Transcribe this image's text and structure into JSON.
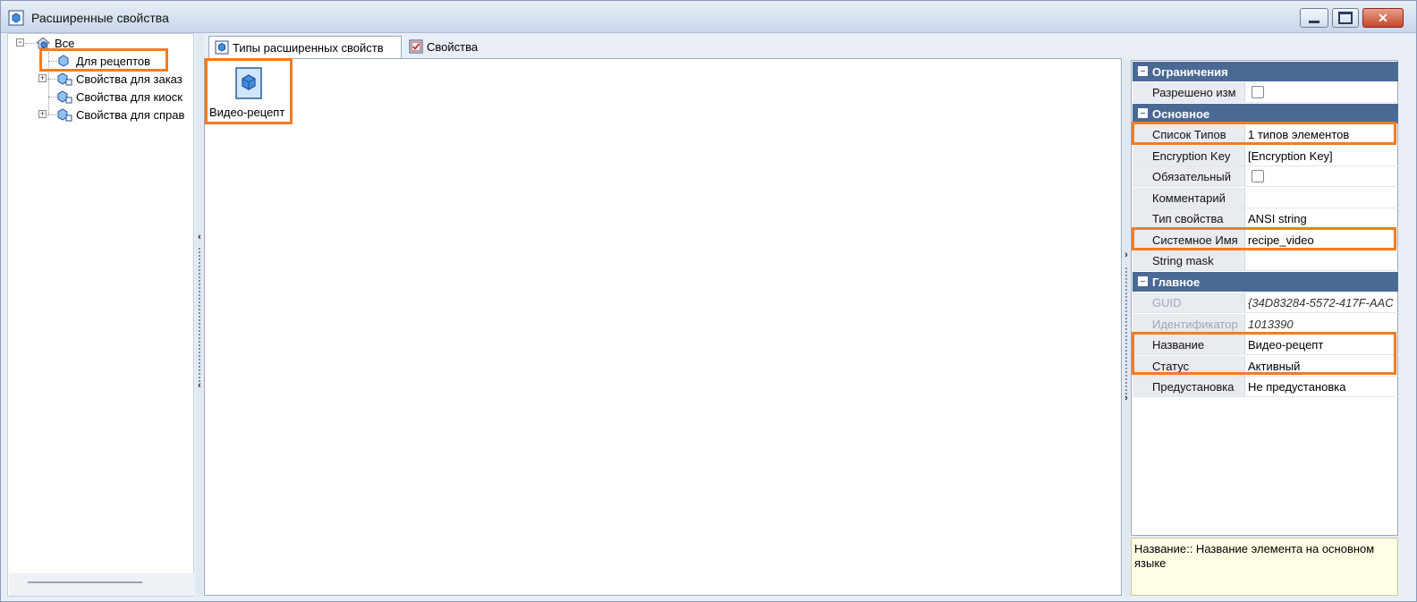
{
  "window": {
    "title": "Расширенные свойства"
  },
  "tree": {
    "root": "Все",
    "items": [
      {
        "label": "Для рецептов",
        "expandable": false
      },
      {
        "label": "Свойства для заказ",
        "expandable": true
      },
      {
        "label": "Свойства для киоск",
        "expandable": false
      },
      {
        "label": "Свойства для справ",
        "expandable": true
      }
    ]
  },
  "tabs": [
    {
      "label": "Типы расширенных свойств",
      "active": true
    },
    {
      "label": "Свойства",
      "active": false
    }
  ],
  "center": {
    "item_label": "Видео-рецепт"
  },
  "properties": {
    "cat1": "Ограничения",
    "r_allowed": {
      "name": "Разрешено изм",
      "checked": false
    },
    "cat2": "Основное",
    "r_typelist": {
      "name": "Список Типов",
      "value": "1 типов элементов"
    },
    "r_enckey": {
      "name": "Encryption Key",
      "value": "[Encryption Key]"
    },
    "r_required": {
      "name": "Обязательный",
      "checked": false
    },
    "r_comment": {
      "name": "Комментарий",
      "value": ""
    },
    "r_proptype": {
      "name": "Тип свойства",
      "value": "ANSI string"
    },
    "r_sysname": {
      "name": "Системное Имя",
      "value": "recipe_video"
    },
    "r_mask": {
      "name": "String mask",
      "value": ""
    },
    "cat3": "Главное",
    "r_guid": {
      "name": "GUID",
      "value": "{34D83284-5572-417F-AAC"
    },
    "r_id": {
      "name": "Идентификатор",
      "value": "1013390"
    },
    "r_title": {
      "name": "Название",
      "value": "Видео-рецепт"
    },
    "r_status": {
      "name": "Статус",
      "value": "Активный"
    },
    "r_preset": {
      "name": "Предустановка",
      "value": "Не предустановка"
    }
  },
  "description": "Название:: Название элемента на основном языке",
  "colors": {
    "highlight": "#f47b1f",
    "category": "#4a6a95",
    "description_bg": "#ffffe6"
  }
}
